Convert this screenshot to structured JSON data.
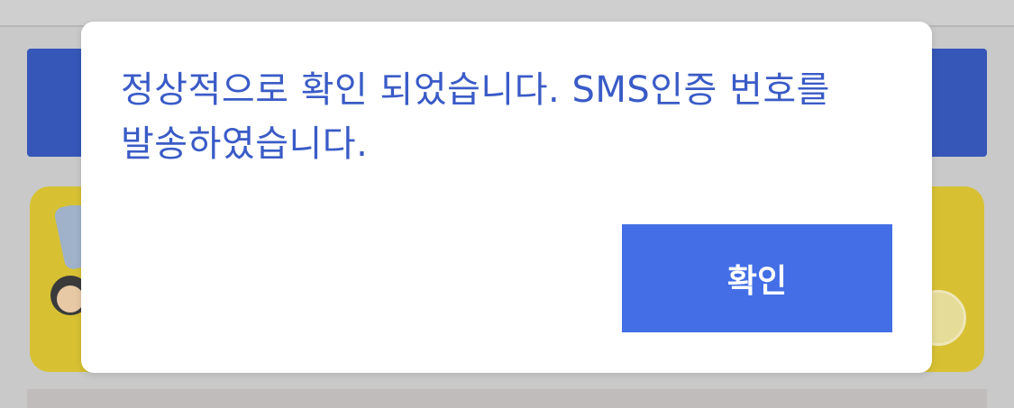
{
  "dialog": {
    "message": "정상적으로 확인 되었습니다. SMS인증 번호를 발송하였습니다.",
    "confirm_label": "확인"
  },
  "colors": {
    "overlay_background": "#c9c9c9",
    "message_text": "#3a5bc7",
    "confirm_button": "#436ee6",
    "background_blue_bar": "#3657b8",
    "background_card_yellow": "#d7c133"
  }
}
